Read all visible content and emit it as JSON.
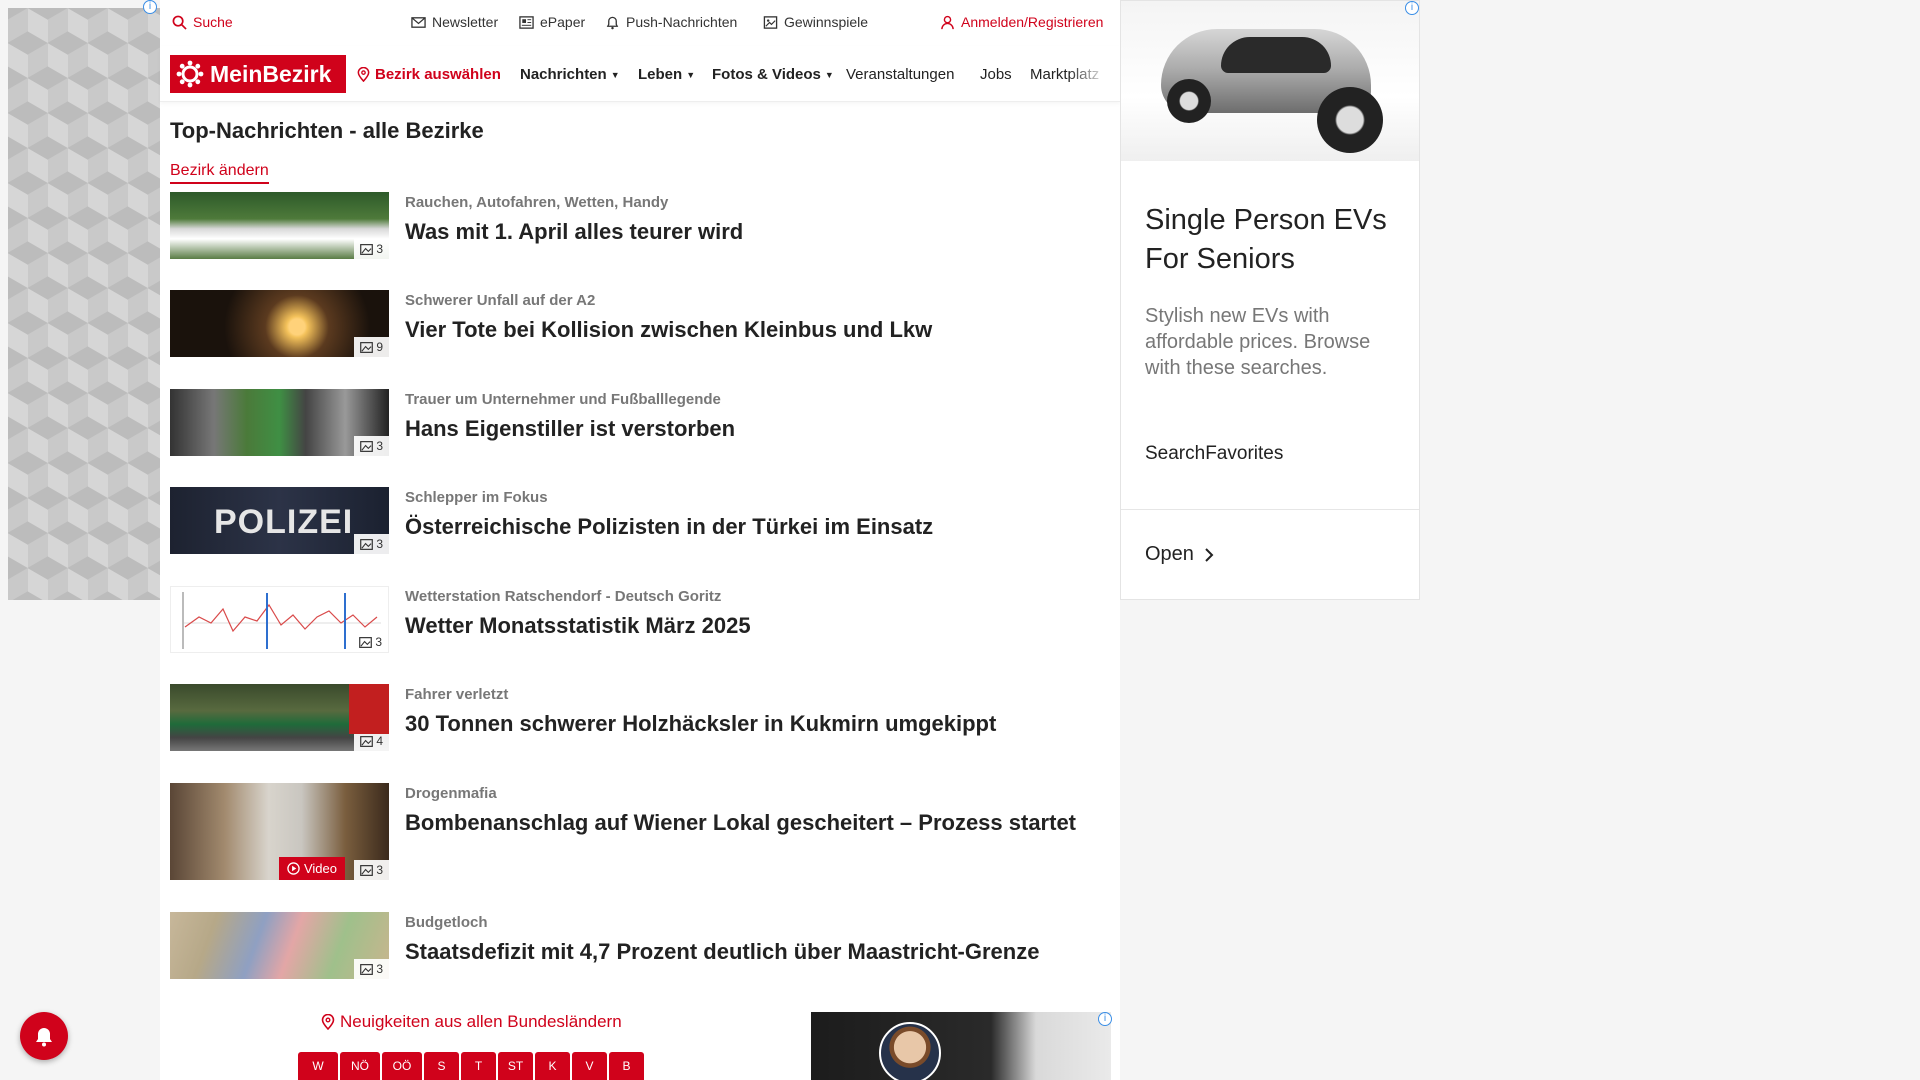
{
  "topbar": {
    "search": "Suche",
    "newsletter": "Newsletter",
    "epaper": "ePaper",
    "push": "Push-Nachrichten",
    "gewinnspiele": "Gewinnspiele",
    "login": "Anmelden/Registrieren"
  },
  "navbar": {
    "logo": "MeinBezirk",
    "select_district": "Bezirk auswählen",
    "items": [
      "Nachrichten",
      "Leben",
      "Fotos & Videos",
      "Veranstaltungen",
      "Jobs",
      "Marktplatz"
    ]
  },
  "main": {
    "title": "Top-Nachrichten - alle Bezirke",
    "change_link": "Bezirk ändern",
    "articles": [
      {
        "kicker": "Rauchen, Autofahren, Wetten, Handy",
        "headline": "Was mit 1. April alles teurer wird",
        "images": "3"
      },
      {
        "kicker": "Schwerer Unfall auf der A2",
        "headline": "Vier Tote bei Kollision zwischen Kleinbus und Lkw",
        "images": "9"
      },
      {
        "kicker": "Trauer um Unternehmer und Fußballlegende",
        "headline": "Hans Eigenstiller ist verstorben",
        "images": "3"
      },
      {
        "kicker": "Schlepper im Fokus",
        "headline": "Österreichische Polizisten in der Türkei im Einsatz",
        "images": "3",
        "thumb_text": "POLIZEI"
      },
      {
        "kicker": "Wetterstation Ratschendorf - Deutsch Goritz",
        "headline": "Wetter Monatsstatistik März 2025",
        "images": "3"
      },
      {
        "kicker": "Fahrer verletzt",
        "headline": "30 Tonnen schwerer Holzhäcksler in Kukmirn umgekippt",
        "images": "4"
      },
      {
        "kicker": "Drogenmafia",
        "headline": "Bombenanschlag auf Wiener Lokal gescheitert – Prozess startet",
        "images": "3",
        "video": "Video"
      },
      {
        "kicker": "Budgetloch",
        "headline": "Staatsdefizit mit 4,7 Prozent deutlich über Maastricht-Grenze",
        "images": "3"
      }
    ]
  },
  "regions": {
    "heading": "Neuigkeiten aus allen Bundesländern",
    "tabs": [
      "W",
      "NÖ",
      "OÖ",
      "S",
      "T",
      "ST",
      "K",
      "V",
      "B"
    ]
  },
  "right_ad": {
    "title": "Single Person EVs For Seniors",
    "description": "Stylish new EVs with affordable prices. Browse with these searches.",
    "brand": "SearchFavorites",
    "cta": "Open"
  },
  "colors": {
    "brand_red": "#d0021b",
    "ad_info_blue": "#3a8ee6"
  },
  "icons": {
    "search": "search-icon",
    "newsletter": "mail-icon",
    "epaper": "newspaper-icon",
    "push": "bell-icon",
    "gewinnspiele": "gift-icon",
    "login": "user-icon",
    "location": "map-pin-icon",
    "gallery": "image-icon"
  }
}
